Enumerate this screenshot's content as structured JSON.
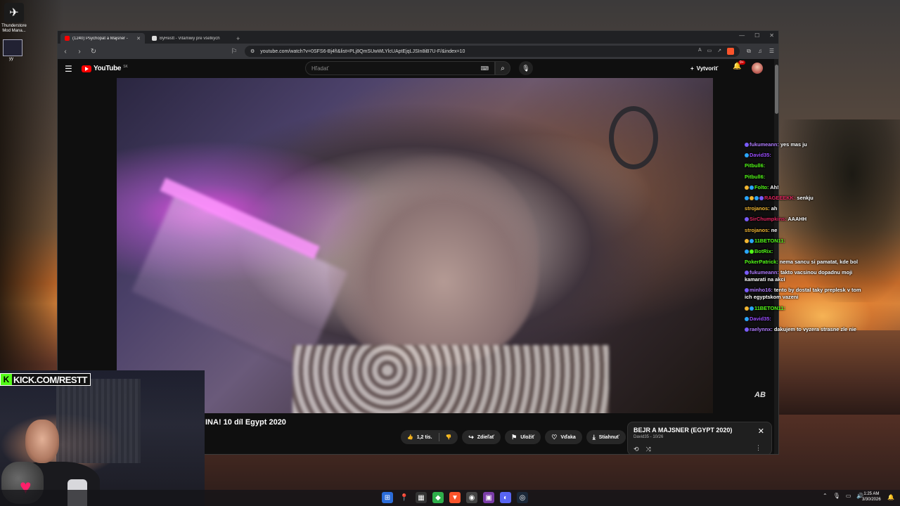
{
  "desktop": {
    "icon1_label": "Thunderstore Mod Mana...",
    "icon2_label": "yy"
  },
  "browser": {
    "tabs": [
      {
        "label": "(1240) Psychopat a Majsner -",
        "active": true,
        "favicon_color": "#ff0000"
      },
      {
        "label": "ByRestt - Vitamiwy pre všetkých",
        "active": false,
        "favicon_color": "#dddddd"
      }
    ],
    "url": "youtube.com/watch?v=0SFS6-Bj4fI&list=PLj8QmSUwWLYlcUAptEjqLJSIn8iB7U-F/&index=10"
  },
  "youtube": {
    "logo_text": "YouTube",
    "country_code": "SK",
    "search_placeholder": "Hľadať",
    "create_label": "Vytvoriť",
    "notification_badge": "9+",
    "video_title": "INA! 10 díl Egypt 2020",
    "like_count": "1,2 tis.",
    "share_label": "Zdieľať",
    "save_label": "Uložiť",
    "thanks_label": "Vďaka",
    "download_label": "Stiahnuť",
    "playlist": {
      "title": "BEJR A MAJSNER (EGYPT 2020)",
      "subtitle": "David35 - 10/26"
    }
  },
  "chat": [
    {
      "user": "fukumeann",
      "text": "yes mas ju",
      "color": "#b07cff",
      "badges": [
        "#7a5cff"
      ]
    },
    {
      "user": "David35",
      "text": "",
      "color": "#9b4dff",
      "badges": [
        "#2aa7ff"
      ]
    },
    {
      "user": "Pitbull6",
      "text": "",
      "color": "#53fc18",
      "badges": []
    },
    {
      "user": "Pitbull6",
      "text": "",
      "color": "#53fc18",
      "badges": []
    },
    {
      "user": "Folto",
      "text": "Ah!",
      "color": "#53fc18",
      "badges": [
        "#f2b632",
        "#2aa7ff"
      ]
    },
    {
      "user": "RAGEEEKK",
      "text": "senkju",
      "color": "#e0245e",
      "badges": [
        "#2aa7ff",
        "#f2b632",
        "#2aa7ff",
        "#7a5cff"
      ]
    },
    {
      "user": "strojanos",
      "text": "ah",
      "color": "#f2b632",
      "badges": []
    },
    {
      "user": "SirChumpkins",
      "text": "AAAHH",
      "color": "#e0245e",
      "badges": [
        "#7a5cff"
      ]
    },
    {
      "user": "strojanos",
      "text": "ne",
      "color": "#f2b632",
      "badges": []
    },
    {
      "user": "11BETON11",
      "text": "",
      "color": "#53fc18",
      "badges": [
        "#f2b632",
        "#2aa7ff"
      ]
    },
    {
      "user": "BotRix",
      "text": "",
      "color": "#53fc18",
      "badges": [
        "#2aa7ff",
        "#53fc18"
      ]
    },
    {
      "user": "PokerPatrick",
      "text": "nema sancu si pamatat, kde bol",
      "color": "#53fc18",
      "badges": []
    },
    {
      "user": "fukumeann",
      "text": "takto vacsinou dopadnu moji kamarati na akci",
      "color": "#b07cff",
      "badges": [
        "#7a5cff"
      ]
    },
    {
      "user": "minho16",
      "text": "tento by dostal taky preplesk v tom ich egyptskom vazeni",
      "color": "#b07cff",
      "badges": [
        "#7a5cff"
      ]
    },
    {
      "user": "11BETON11",
      "text": "",
      "color": "#53fc18",
      "badges": [
        "#f2b632",
        "#2aa7ff"
      ]
    },
    {
      "user": "David35",
      "text": "",
      "color": "#9b4dff",
      "badges": [
        "#2aa7ff"
      ]
    },
    {
      "user": "raelynnx",
      "text": "dakujem to vyzera strasne zle nie",
      "color": "#b07cff",
      "badges": [
        "#7a5cff"
      ]
    }
  ],
  "stream_overlay": {
    "kick_label": "KICK.COM/RESTT",
    "corner_logo": "AB"
  },
  "taskbar": {
    "time": "1:25 AM",
    "date": "3/30/2026"
  }
}
